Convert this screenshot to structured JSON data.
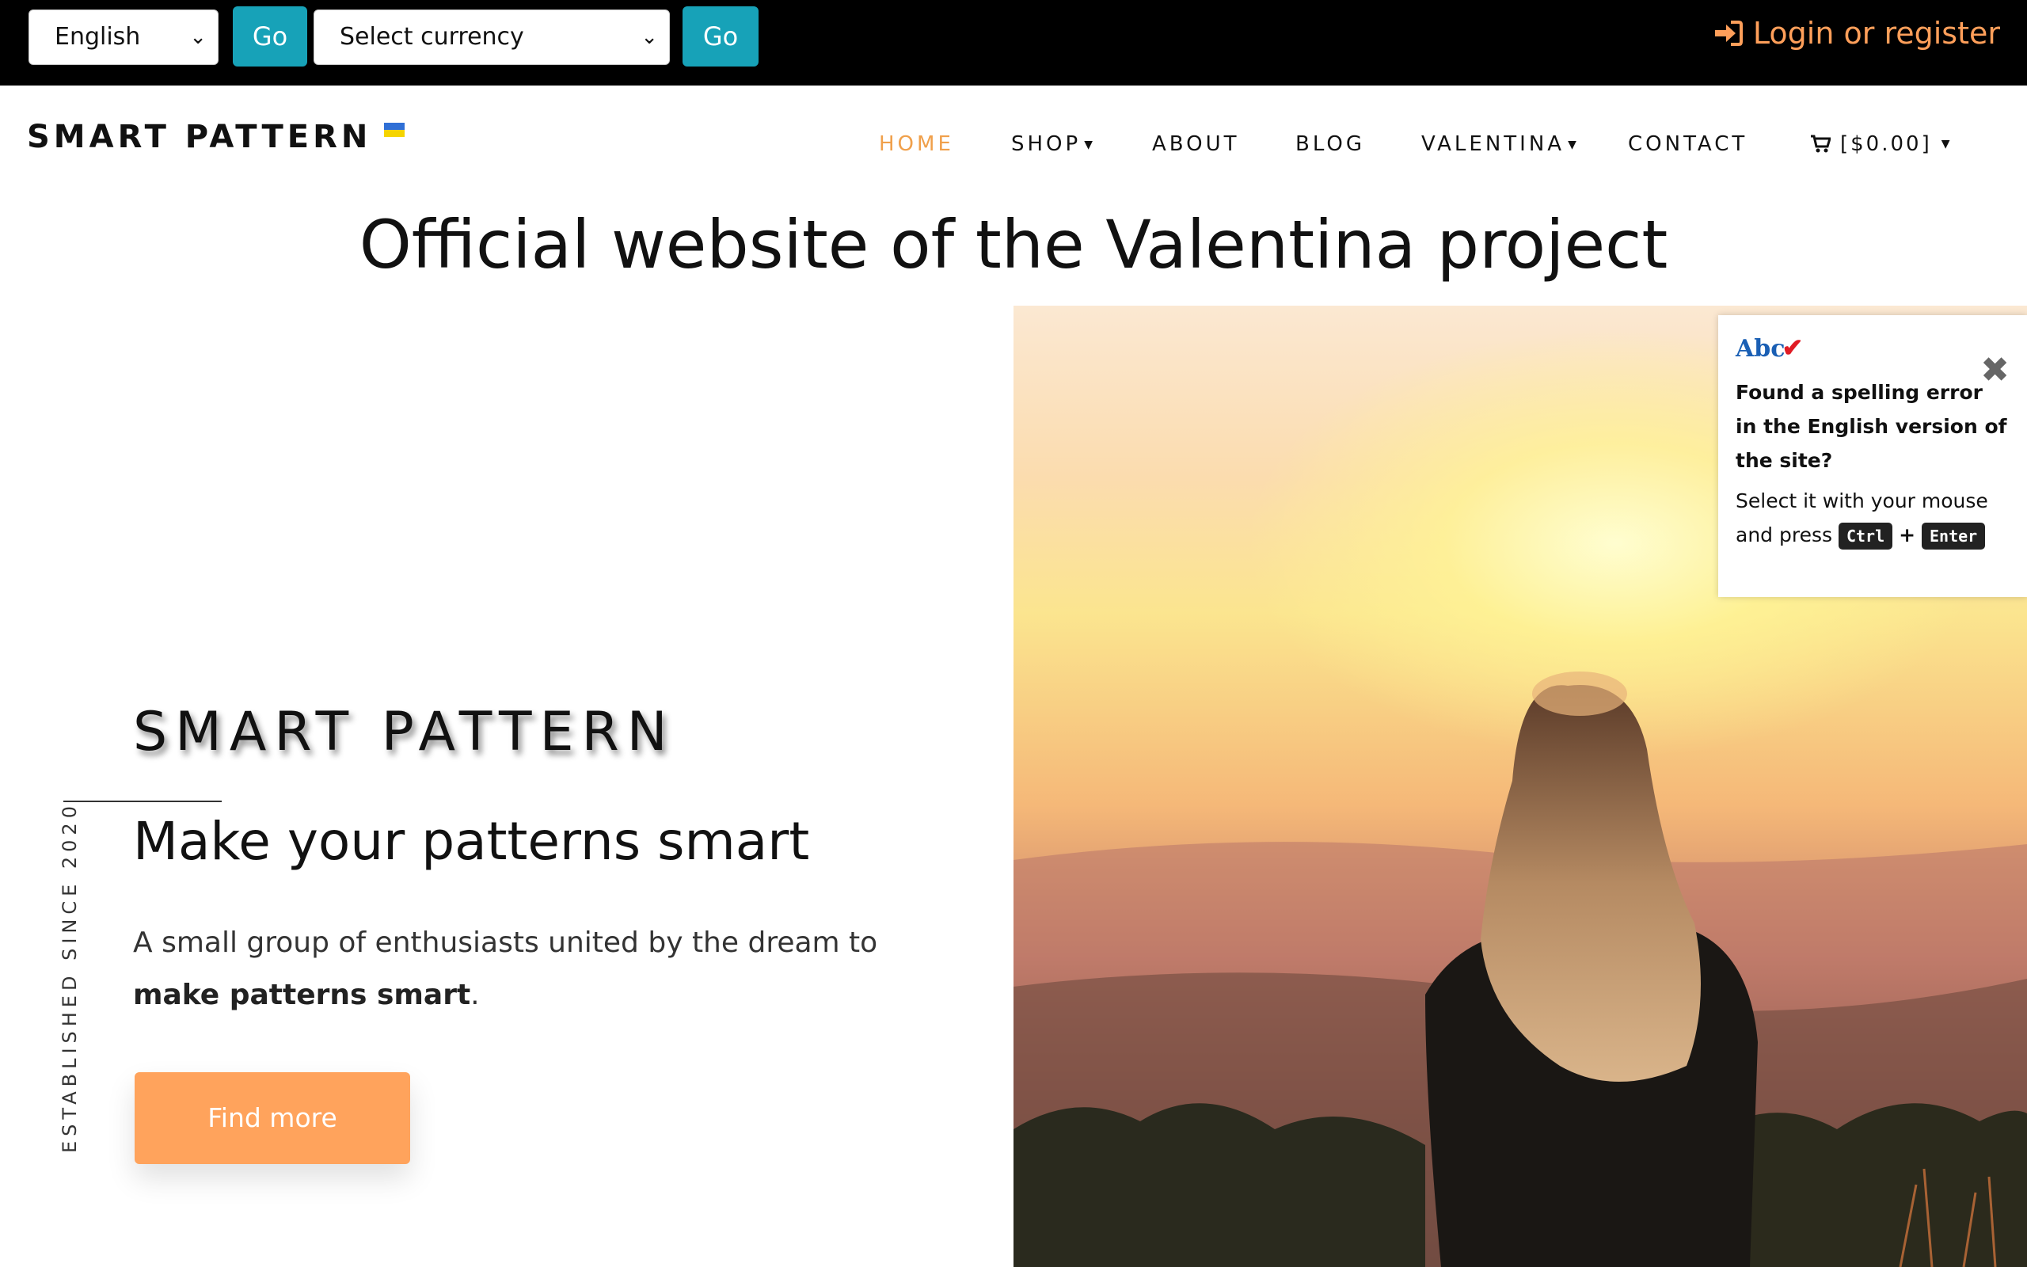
{
  "topbar": {
    "language_select": "English",
    "go_label": "Go",
    "currency_select": "Select currency",
    "go2_label": "Go",
    "login_label": "Login or register"
  },
  "header": {
    "brand": "SMART PATTERN",
    "nav": [
      {
        "label": "HOME",
        "active": true
      },
      {
        "label": "SHOP",
        "dropdown": true
      },
      {
        "label": "ABOUT"
      },
      {
        "label": "BLOG"
      },
      {
        "label": "VALENTINA",
        "dropdown": true
      },
      {
        "label": "CONTACT"
      }
    ],
    "cart_label": "[$0.00]"
  },
  "headline": "Official website of the Valentina project",
  "hero": {
    "established": "ESTABLISHED SINCE 2020",
    "title": "SMART PATTERN",
    "tagline": "Make your patterns smart",
    "desc_prefix": "A small group of enthusiasts united by the dream to ",
    "desc_bold": "make patterns smart",
    "desc_suffix": ".",
    "button_label": "Find more"
  },
  "spelling_popup": {
    "logo_text": "Abc",
    "title": "Found a spelling error in the English version of the site?",
    "text": "Select it with your mouse and press",
    "key1": "Ctrl",
    "plus": "+",
    "key2": "Enter"
  },
  "colors": {
    "accent_orange": "#ffa35c",
    "nav_active": "#f0a04b",
    "go_button": "#17a2b8",
    "topbar_bg": "#000000"
  }
}
